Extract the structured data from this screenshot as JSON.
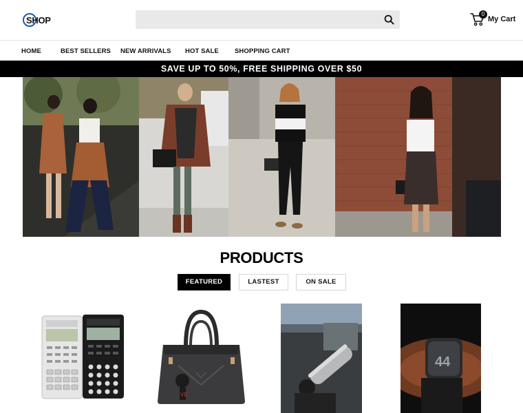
{
  "header": {
    "logo_text": "SHOP",
    "search_placeholder": "",
    "cart_count": "0",
    "cart_label": "My Cart"
  },
  "nav": {
    "items": [
      {
        "label": "HOME"
      },
      {
        "label": "BEST SELLERS"
      },
      {
        "label": "NEW ARRIVALS"
      },
      {
        "label": "HOT SALE"
      },
      {
        "label": "SHOPPING CART"
      }
    ]
  },
  "promo": {
    "text": "SAVE UP TO 50%, FREE SHIPPING OVER $50"
  },
  "products": {
    "title": "PRODUCTS",
    "tabs": [
      {
        "label": "FEATURED",
        "active": true
      },
      {
        "label": "LASTEST",
        "active": false
      },
      {
        "label": "ON SALE",
        "active": false
      }
    ],
    "items": [
      {
        "name": "calculators-image"
      },
      {
        "name": "handbag-image"
      },
      {
        "name": "machine-image"
      },
      {
        "name": "smartwatch-image",
        "display_text": "44"
      }
    ]
  },
  "colors": {
    "accent": "#000000",
    "logo_blue": "#1e5ca8",
    "search_bg": "#e9e9e9"
  }
}
